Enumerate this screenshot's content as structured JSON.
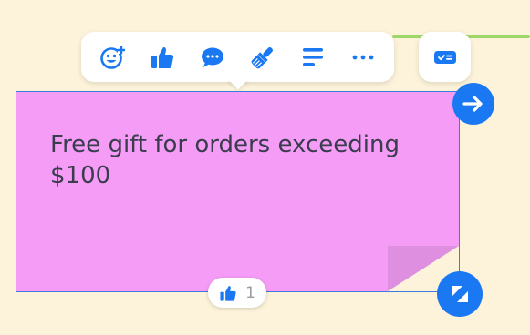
{
  "toolbar": {
    "items": [
      {
        "icon": "emoji-add-icon"
      },
      {
        "icon": "thumbs-up-icon"
      },
      {
        "icon": "comment-icon"
      },
      {
        "icon": "paintbrush-icon"
      },
      {
        "icon": "text-align-icon"
      },
      {
        "icon": "more-icon"
      }
    ],
    "card_icon": "card-icon"
  },
  "sticky": {
    "text": "Free gift for orders exceeding $100",
    "color": "#f59cf7"
  },
  "reaction": {
    "icon": "thumbs-up-icon",
    "count": "1"
  },
  "colors": {
    "accent": "#1a78f2",
    "canvas": "#fcf3da",
    "connector": "#9ed66a"
  }
}
